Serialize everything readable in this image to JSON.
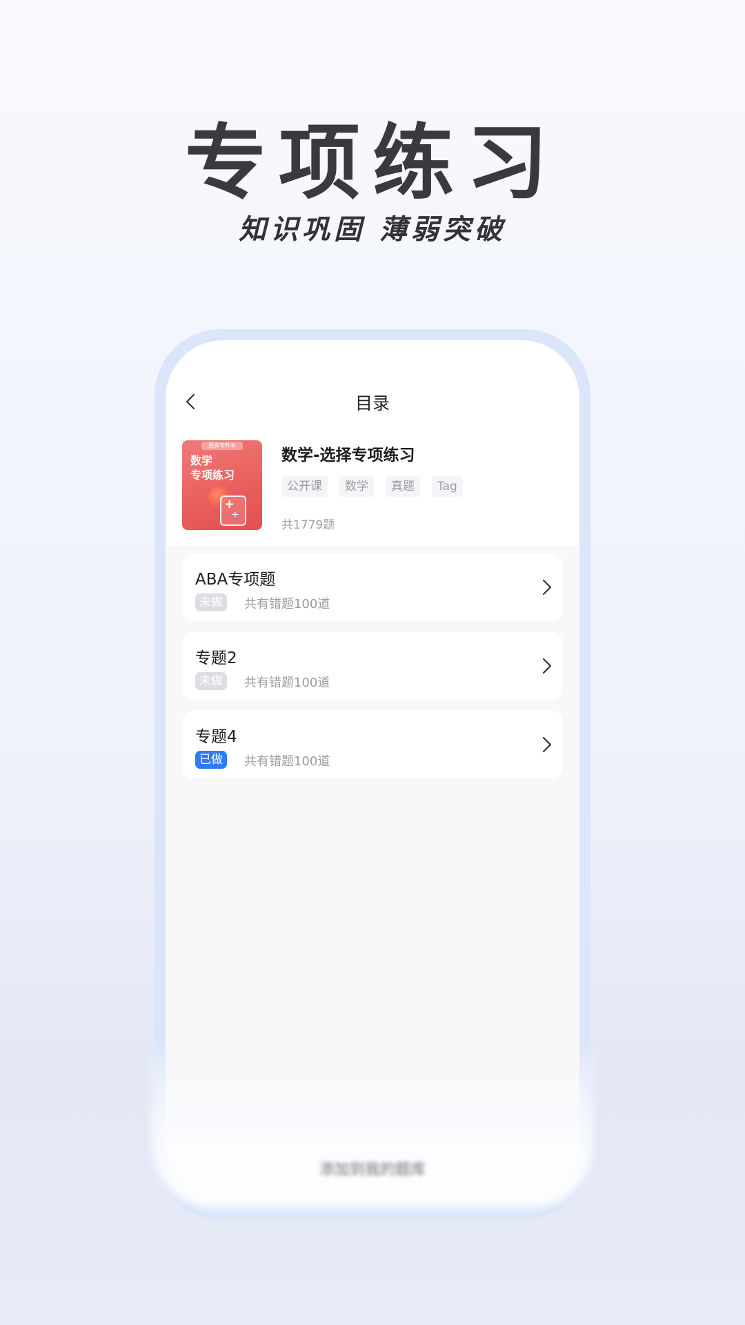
{
  "hero": {
    "title": "专项练习",
    "subtitle": "知识巩固 薄弱突破"
  },
  "nav": {
    "title": "目录",
    "back_icon": "chevron-left-icon"
  },
  "book": {
    "cover": {
      "badge": "贵贵专升本",
      "line1": "数学",
      "line2": "专项练习"
    },
    "title": "数学-选择专项练习",
    "tags": [
      "公开课",
      "数学",
      "真题",
      "Tag"
    ],
    "count": "共1779题"
  },
  "items": [
    {
      "title": "ABA专项题",
      "status": "未做",
      "desc": "共有错题100道"
    },
    {
      "title": "专题2",
      "status": "未做",
      "desc": "共有错题100道"
    },
    {
      "title": "专题4",
      "status": "已做",
      "desc": "共有错题100道"
    }
  ],
  "bottom_bar": {
    "label": "添加到我的题库"
  },
  "colors": {
    "accent": "#2e7cf6",
    "undone_badge": "#dcdde2",
    "cover_red": "#e85e5d"
  }
}
